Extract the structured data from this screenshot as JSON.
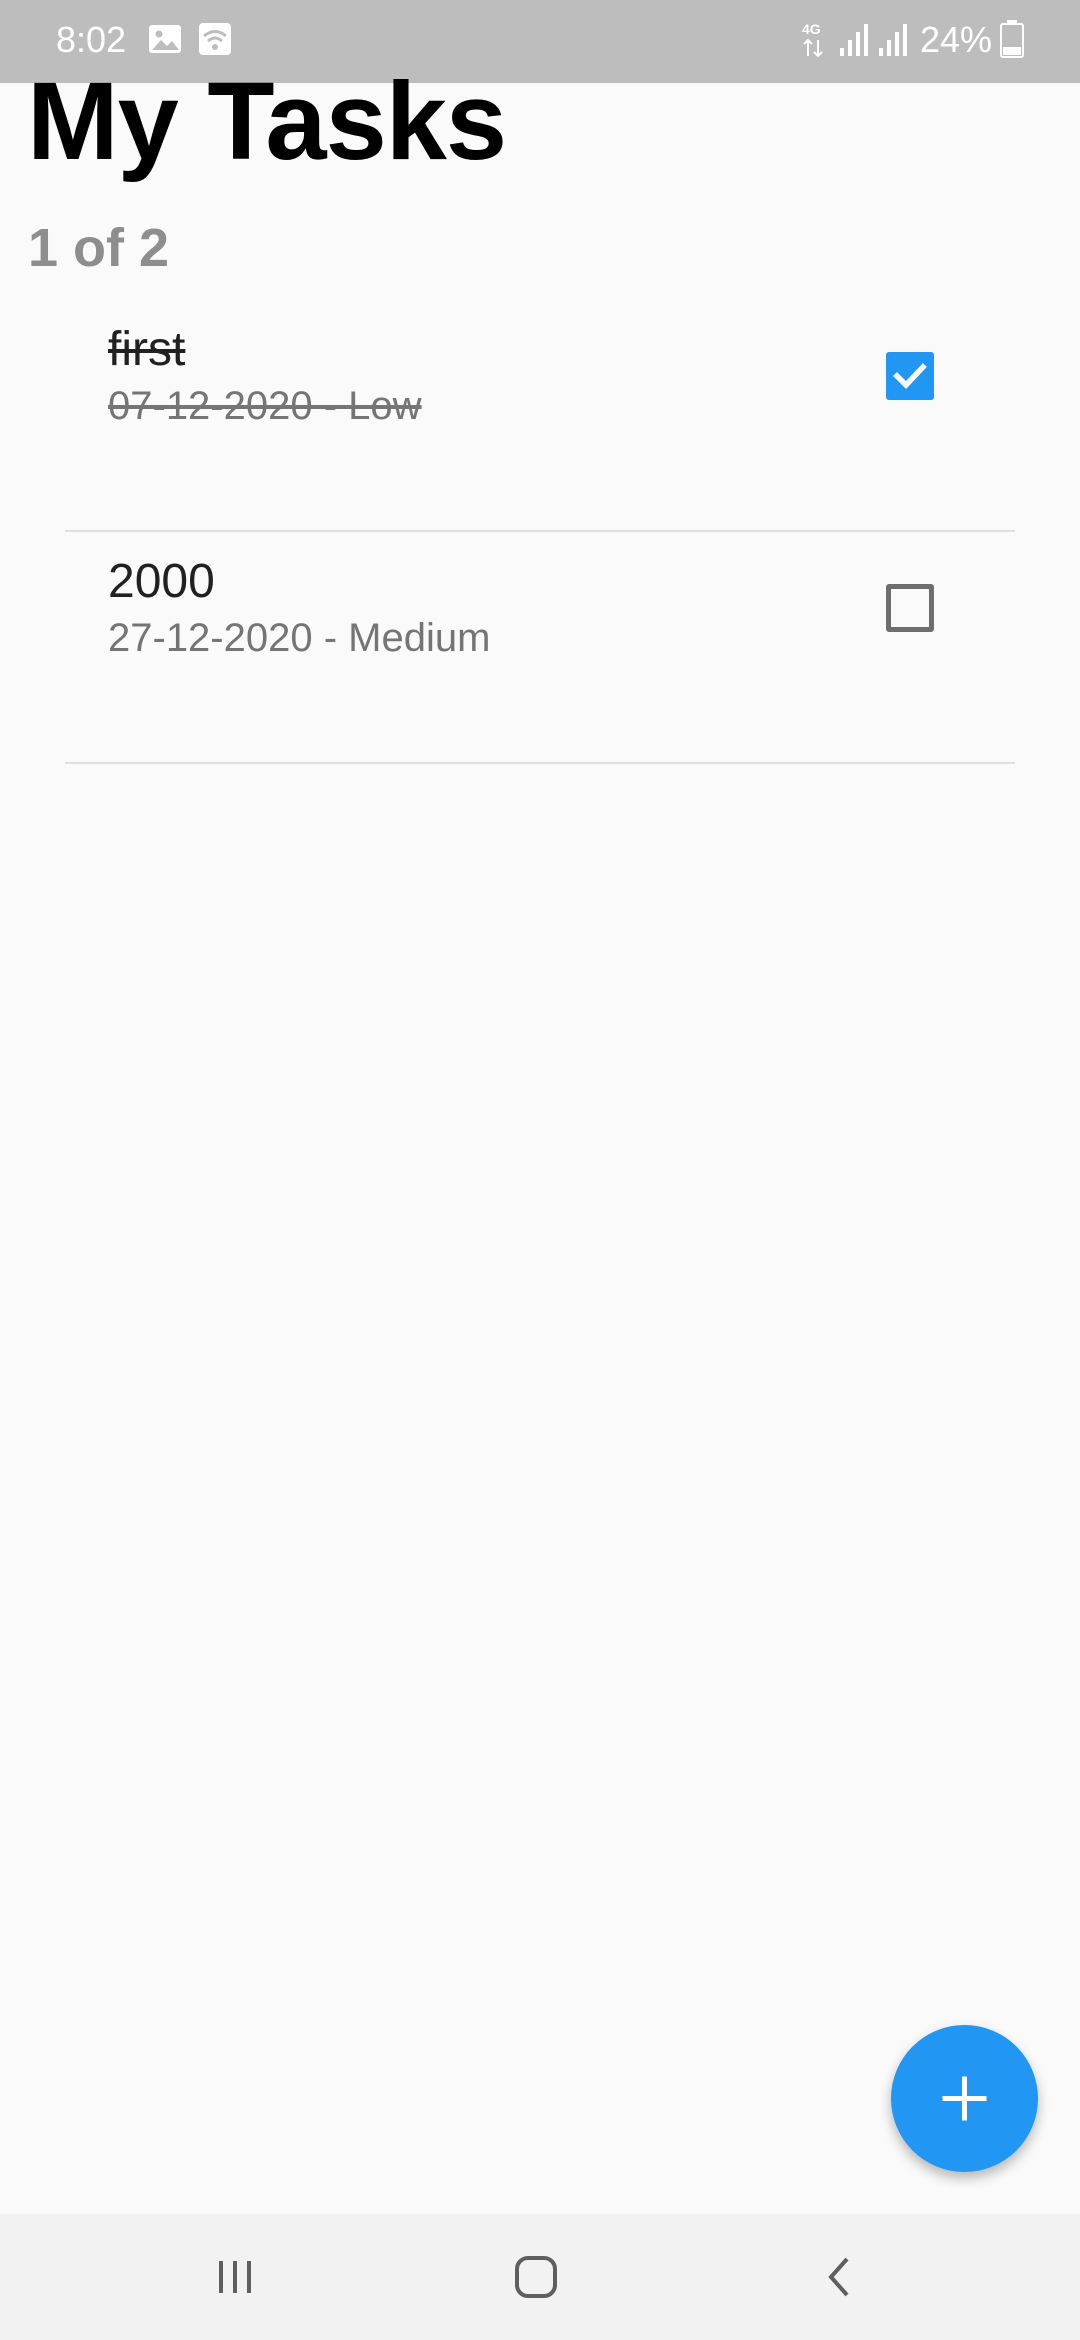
{
  "status_bar": {
    "time": "8:02",
    "battery": "24%",
    "icons": [
      "image-icon",
      "wifi-icon",
      "4g-icon",
      "signal-icon",
      "signal-icon",
      "battery-icon"
    ]
  },
  "header": {
    "title": "My Tasks",
    "count": "1 of 2"
  },
  "tasks": [
    {
      "title": "first",
      "subtitle": "07-12-2020 - Low",
      "done": true
    },
    {
      "title": "2000",
      "subtitle": "27-12-2020 - Medium",
      "done": false
    }
  ],
  "fab": {
    "icon": "plus-icon"
  },
  "nav_bar": {
    "icons": [
      "recents-icon",
      "home-icon",
      "back-icon"
    ]
  },
  "colors": {
    "accent": "#2196f3",
    "status_bar": "#bdbdbd",
    "background": "#fafafa"
  }
}
